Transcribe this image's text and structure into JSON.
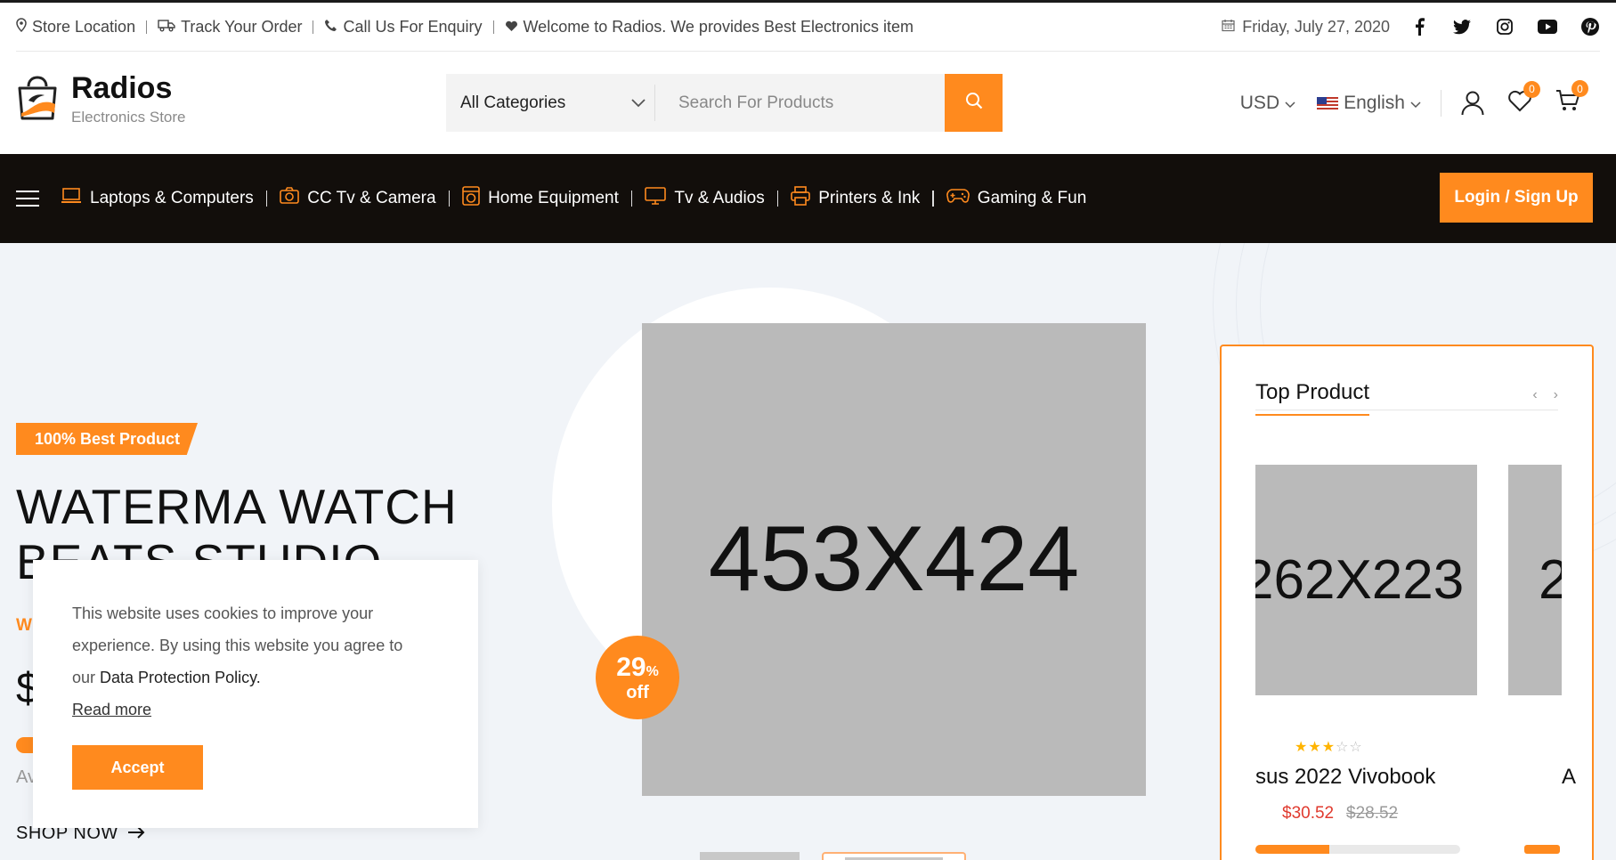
{
  "topbar": {
    "store_location": "Store Location",
    "track_order": "Track Your Order",
    "call_us": "Call Us For Enquiry",
    "welcome": "Welcome to Radios. We provides Best Electronics item",
    "date": "Friday, July 27, 2020",
    "social_icons": [
      "facebook-icon",
      "twitter-icon",
      "instagram-icon",
      "youtube-icon",
      "pinterest-icon"
    ]
  },
  "header": {
    "logo_title": "Radios",
    "logo_subtitle": "Electronics Store",
    "category_select": "All Categories",
    "search_placeholder": "Search For Products",
    "currency": "USD",
    "language": "English",
    "wishlist_count": "0",
    "cart_count": "0"
  },
  "nav": {
    "items": [
      {
        "label": "Laptops & Computers",
        "icon": "laptop-icon"
      },
      {
        "label": "CC Tv & Camera",
        "icon": "camera-icon"
      },
      {
        "label": "Home Equipment",
        "icon": "washing-machine-icon"
      },
      {
        "label": "Tv & Audios",
        "icon": "tv-icon"
      },
      {
        "label": "Printers & Ink",
        "icon": "printer-icon"
      },
      {
        "label": "Gaming & Fun",
        "icon": "gamepad-icon"
      }
    ],
    "login": "Login / Sign Up"
  },
  "hero": {
    "tag": "100% Best Product",
    "title": "WATERMA WATCH BEATS STUDIO",
    "subtitle_fragment": "W",
    "price_fragment": "$",
    "availability_fragment": "Av",
    "shop_now": "SHOP NOW",
    "main_image_placeholder": "453X424",
    "discount_value": "29",
    "discount_unit": "%",
    "discount_label": "off"
  },
  "top_product": {
    "title": "Top Product",
    "cards": [
      {
        "image_placeholder": "262X223",
        "name": "sus 2022 Vivobook",
        "price": "$30.52",
        "old_price": "$28.52",
        "rating": 3,
        "rating_max": 5,
        "stock_fraction": 0.36
      },
      {
        "image_placeholder": "2",
        "name": "A"
      }
    ]
  },
  "cookie": {
    "text": "This website uses cookies to improve your experience. By using this website you agree to our",
    "policy": "Data Protection Policy.",
    "read_more": "Read more",
    "accept": "Accept"
  },
  "colors": {
    "accent": "#ff8a1e",
    "nav_bg": "#120e0b",
    "price_red": "#e03a2e"
  }
}
